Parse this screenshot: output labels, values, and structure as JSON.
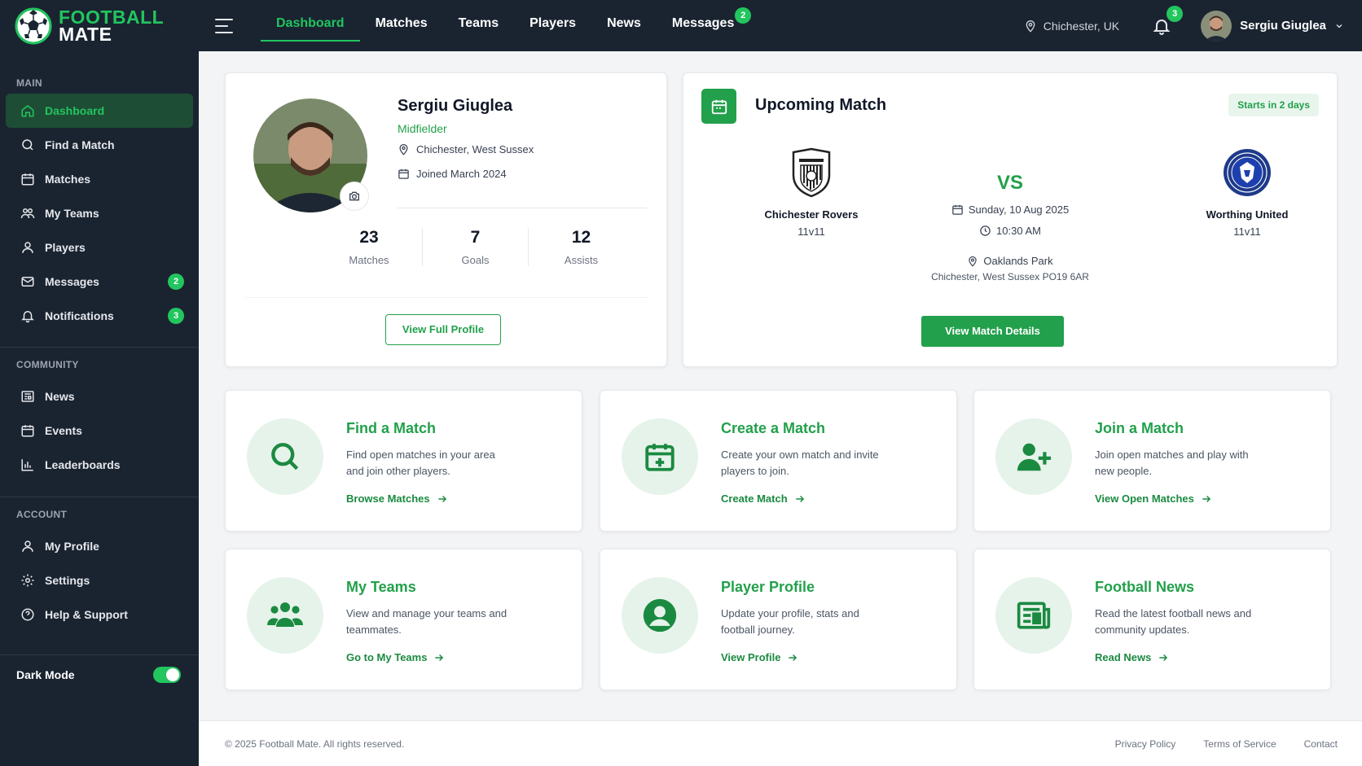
{
  "brand": {
    "line1": "FOOTBALL",
    "line2": "MATE"
  },
  "topnav": {
    "items": [
      {
        "label": "Dashboard"
      },
      {
        "label": "Matches"
      },
      {
        "label": "Teams"
      },
      {
        "label": "Players"
      },
      {
        "label": "News"
      },
      {
        "label": "Messages",
        "badge": "2"
      }
    ],
    "active": "Dashboard",
    "location": "Chichester, UK",
    "notification_count": "3",
    "user_name": "Sergiu Giuglea"
  },
  "sidebar": {
    "main_title": "MAIN",
    "main": [
      {
        "label": "Dashboard",
        "icon": "home-icon"
      },
      {
        "label": "Find a Match",
        "icon": "search-icon"
      },
      {
        "label": "Matches",
        "icon": "calendar-icon"
      },
      {
        "label": "My Teams",
        "icon": "teams-icon"
      },
      {
        "label": "Players",
        "icon": "user-icon"
      },
      {
        "label": "Messages",
        "icon": "mail-icon",
        "badge": "2"
      },
      {
        "label": "Notifications",
        "icon": "bell-icon",
        "badge": "3"
      }
    ],
    "community_title": "COMMUNITY",
    "community": [
      {
        "label": "News",
        "icon": "newspaper-icon"
      },
      {
        "label": "Events",
        "icon": "calendar-icon"
      },
      {
        "label": "Leaderboards",
        "icon": "bar-chart-icon"
      }
    ],
    "account_title": "ACCOUNT",
    "account": [
      {
        "label": "My Profile",
        "icon": "user-icon"
      },
      {
        "label": "Settings",
        "icon": "gear-icon"
      },
      {
        "label": "Help & Support",
        "icon": "help-icon"
      }
    ],
    "dark_mode_label": "Dark Mode",
    "dark_mode_on": true
  },
  "profile": {
    "name": "Sergiu Giuglea",
    "position": "Midfielder",
    "location": "Chichester, West Sussex",
    "joined": "Joined March 2024",
    "stats": [
      {
        "value": "23",
        "label": "Matches"
      },
      {
        "value": "7",
        "label": "Goals"
      },
      {
        "value": "12",
        "label": "Assists"
      }
    ],
    "button": "View Full Profile"
  },
  "upcoming": {
    "title": "Upcoming Match",
    "countdown": "Starts in 2 days",
    "home": {
      "name": "Chichester Rovers",
      "format": "11v11"
    },
    "away": {
      "name": "Worthing United",
      "format": "11v11"
    },
    "vs": "VS",
    "date": "Sunday, 10 Aug 2025",
    "time": "10:30 AM",
    "venue": "Oaklands Park",
    "address": "Chichester, West Sussex PO19 6AR",
    "button": "View Match Details"
  },
  "features": [
    {
      "title": "Find a Match",
      "desc": "Find open matches in your area and join other players.",
      "link": "Browse Matches",
      "icon": "search-icon"
    },
    {
      "title": "Create a Match",
      "desc": "Create your own match and invite players to join.",
      "link": "Create Match",
      "icon": "calendar-plus-icon"
    },
    {
      "title": "Join a Match",
      "desc": "Join open matches and play with new people.",
      "link": "View Open Matches",
      "icon": "user-plus-icon"
    },
    {
      "title": "My Teams",
      "desc": "View and manage your teams and teammates.",
      "link": "Go to My Teams",
      "icon": "teams-icon"
    },
    {
      "title": "Player Profile",
      "desc": "Update your profile, stats and football journey.",
      "link": "View Profile",
      "icon": "user-circle-icon"
    },
    {
      "title": "Football News",
      "desc": "Read the latest football news and community updates.",
      "link": "Read News",
      "icon": "newspaper-icon"
    }
  ],
  "footer": {
    "copyright": "© 2025 Football Mate. All rights reserved.",
    "links": [
      "Privacy Policy",
      "Terms of Service",
      "Contact"
    ]
  },
  "colors": {
    "accent": "#22a04b",
    "bright": "#22c55e",
    "sidebar": "#1a2431"
  }
}
